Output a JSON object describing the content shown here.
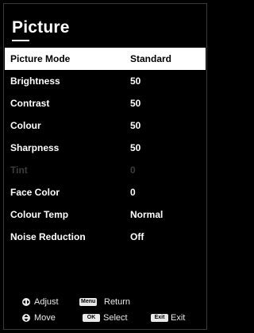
{
  "header": {
    "title": "Picture"
  },
  "menu": {
    "items": [
      {
        "label": "Picture Mode",
        "value": "Standard"
      },
      {
        "label": "Brightness",
        "value": "50"
      },
      {
        "label": "Contrast",
        "value": "50"
      },
      {
        "label": "Colour",
        "value": "50"
      },
      {
        "label": "Sharpness",
        "value": "50"
      },
      {
        "label": "Tint",
        "value": "0"
      },
      {
        "label": "Face Color",
        "value": "0"
      },
      {
        "label": "Colour Temp",
        "value": "Normal"
      },
      {
        "label": "Noise Reduction",
        "value": "Off"
      }
    ]
  },
  "footer": {
    "adjust": {
      "icon": "left-right-icon",
      "label": "Adjust"
    },
    "return": {
      "key": "Menu",
      "label": "Return"
    },
    "move": {
      "icon": "up-down-icon",
      "label": "Move"
    },
    "select": {
      "key": "OK",
      "label": "Select"
    },
    "exit": {
      "key": "Exit",
      "label": "Exit"
    }
  },
  "colors": {
    "background": "#000000",
    "highlight": "#ffffff",
    "disabled": "#3c3c3c"
  }
}
